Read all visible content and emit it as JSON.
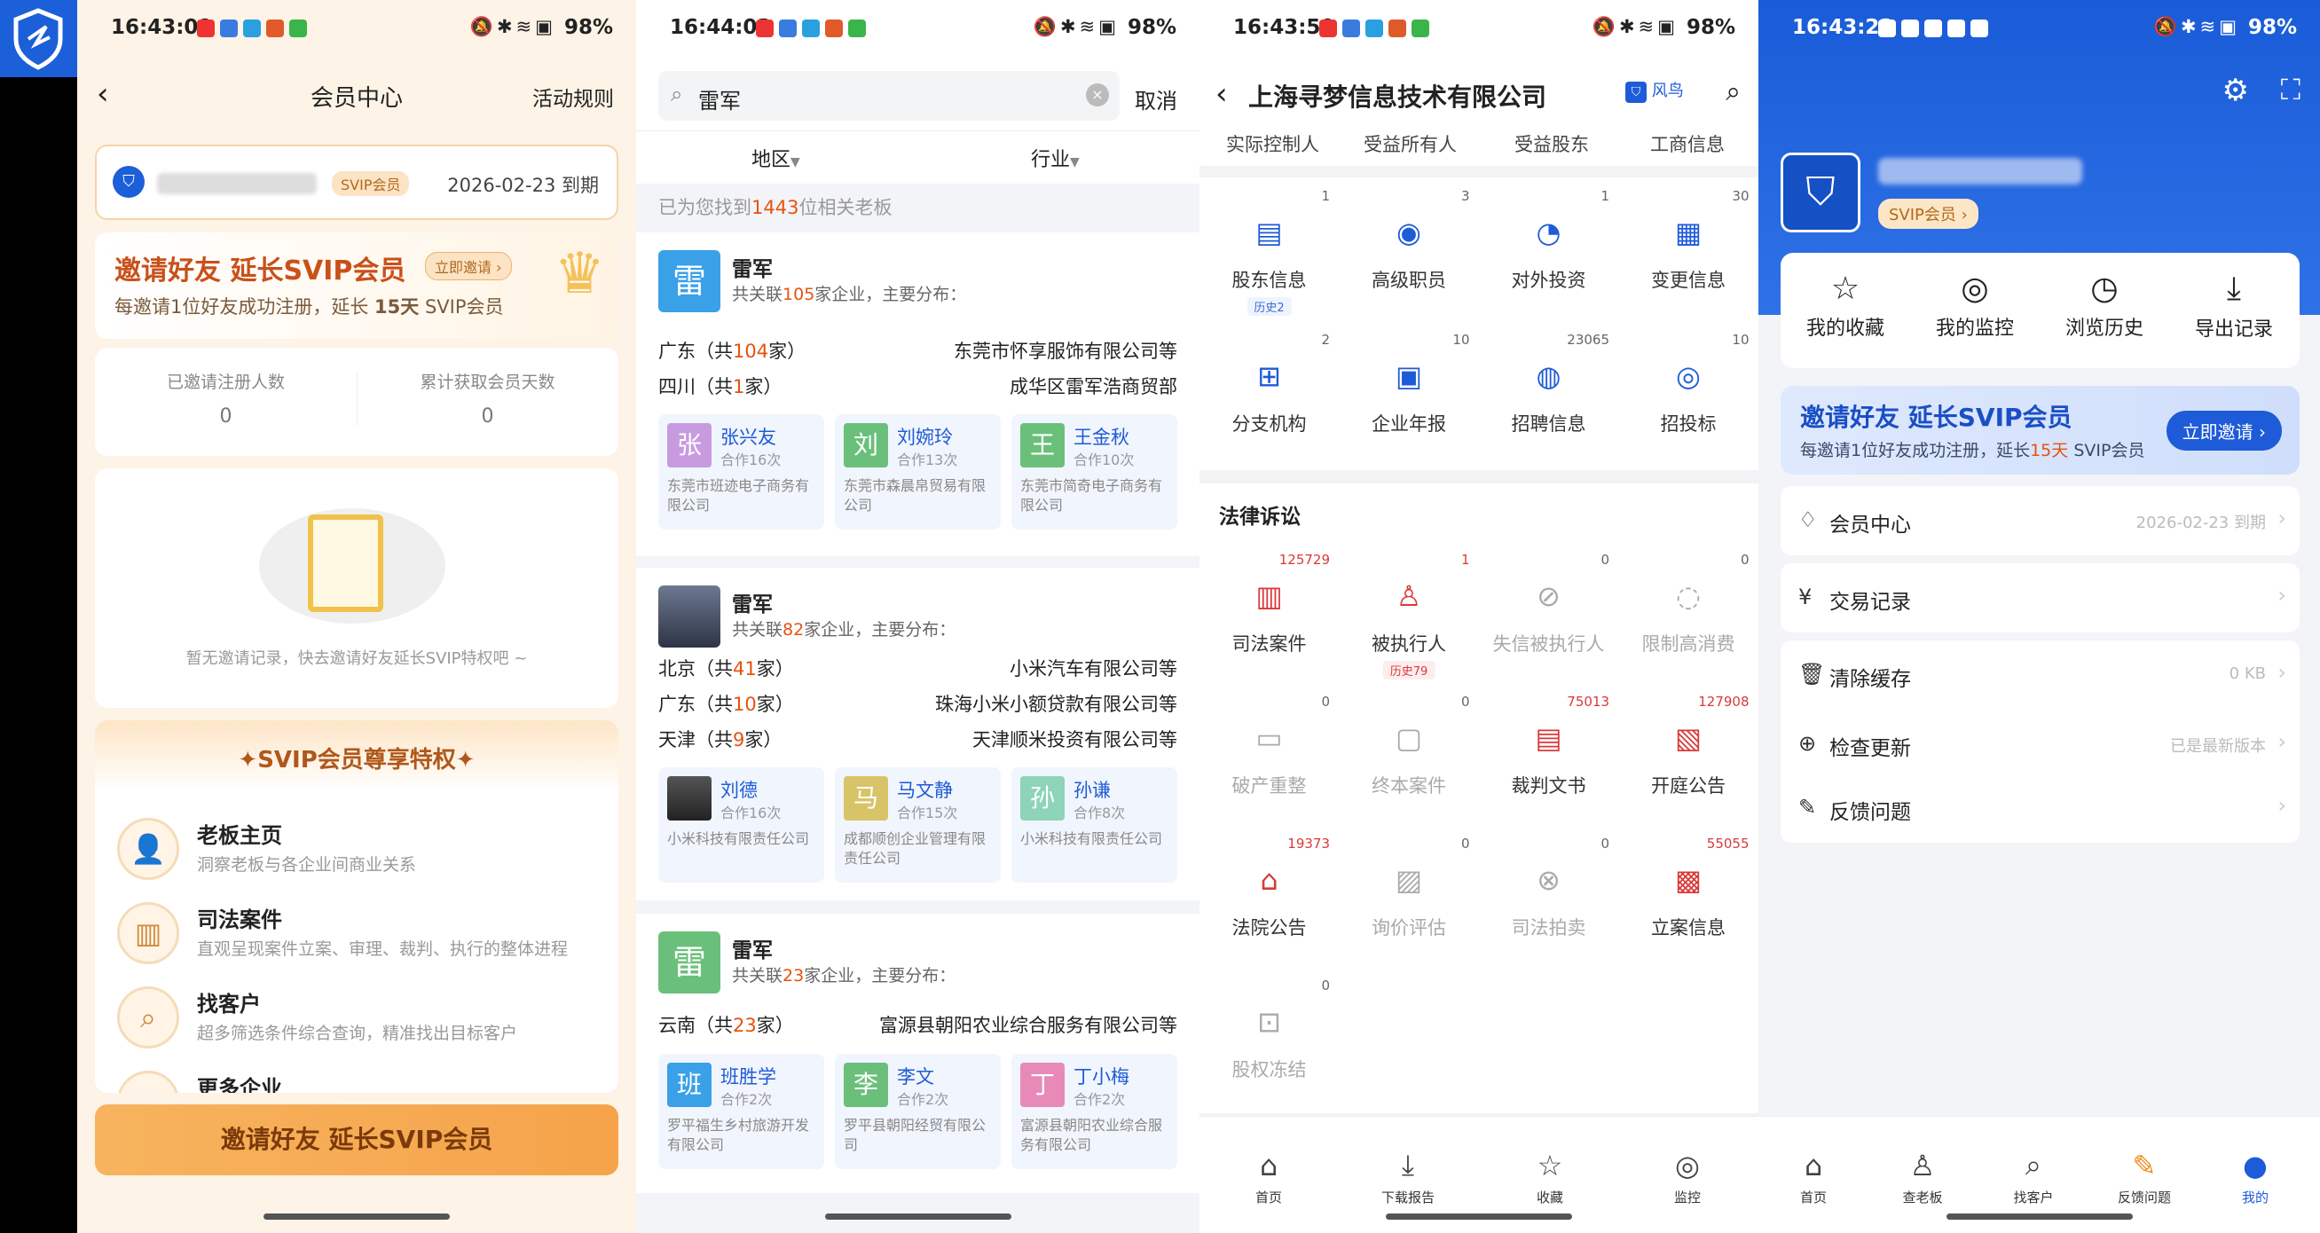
{
  "app_logo_icon": "shield-logo-icon",
  "panel1": {
    "status": {
      "time": "16:43:09",
      "battery": "98%"
    },
    "nav": {
      "title": "会员中心",
      "right": "活动规则"
    },
    "member": {
      "badge": "SVIP会员",
      "expire": "2026-02-23 到期"
    },
    "invite_banner": {
      "title": "邀请好友 延长SVIP会员",
      "btn": "立即邀请",
      "desc_pre": "每邀请1位好友成功注册，延长 ",
      "desc_days": "15天",
      "desc_post": " SVIP会员"
    },
    "stats": [
      {
        "label": "已邀请注册人数",
        "value": "0"
      },
      {
        "label": "累计获取会员天数",
        "value": "0"
      }
    ],
    "empty_text": "暂无邀请记录，快去邀请好友延长SVIP特权吧 ~",
    "priv_title": "✦SVIP会员尊享特权✦",
    "privileges": [
      {
        "title": "老板主页",
        "desc": "洞察老板与各企业间商业关系"
      },
      {
        "title": "司法案件",
        "desc": "直观呈现案件立案、审理、裁判、执行的整体进程"
      },
      {
        "title": "找客户",
        "desc": "超多筛选条件综合查询，精准找出目标客户"
      },
      {
        "title": "更多企业",
        "desc": ""
      }
    ],
    "bottom_btn": "邀请好友 延长SVIP会员"
  },
  "panel2": {
    "status": {
      "time": "16:44:03",
      "battery": "98%"
    },
    "search": {
      "value": "雷军",
      "cancel": "取消"
    },
    "filters": [
      "地区",
      "行业"
    ],
    "found": {
      "pre": "已为您找到",
      "count": "1443",
      "post": "位相关老板"
    },
    "results": [
      {
        "avatar": "雷",
        "name": "雷军",
        "sub_pre": "共关联",
        "sub_num": "105",
        "sub_post": "家企业，主要分布：",
        "rows": [
          {
            "l": "广东（共",
            "n": "104",
            "r": "家）",
            "co": "东莞市怀享服饰有限公司等"
          },
          {
            "l": "四川（共",
            "n": "1",
            "r": "家）",
            "co": "成华区雷军浩商贸部"
          }
        ],
        "partners": [
          {
            "a": "张",
            "n": "张兴友",
            "c": "合作16次",
            "co": "东莞市班迹电子商务有限公司"
          },
          {
            "a": "刘",
            "n": "刘婉玲",
            "c": "合作13次",
            "co": "东莞市森晨帛贸易有限公司"
          },
          {
            "a": "王",
            "n": "王金秋",
            "c": "合作10次",
            "co": "东莞市简奇电子商务有限公司"
          }
        ]
      },
      {
        "avatar": "",
        "name": "雷军",
        "sub_pre": "共关联",
        "sub_num": "82",
        "sub_post": "家企业，主要分布：",
        "rows": [
          {
            "l": "北京（共",
            "n": "41",
            "r": "家）",
            "co": "小米汽车有限公司等"
          },
          {
            "l": "广东（共",
            "n": "10",
            "r": "家）",
            "co": "珠海小米小额贷款有限公司等"
          },
          {
            "l": "天津（共",
            "n": "9",
            "r": "家）",
            "co": "天津顺米投资有限公司等"
          }
        ],
        "partners": [
          {
            "a": "",
            "n": "刘德",
            "c": "合作16次",
            "co": "小米科技有限责任公司"
          },
          {
            "a": "马",
            "n": "马文静",
            "c": "合作15次",
            "co": "成都顺创企业管理有限责任公司"
          },
          {
            "a": "孙",
            "n": "孙谦",
            "c": "合作8次",
            "co": "小米科技有限责任公司"
          }
        ]
      },
      {
        "avatar": "雷",
        "name": "雷军",
        "sub_pre": "共关联",
        "sub_num": "23",
        "sub_post": "家企业，主要分布：",
        "rows": [
          {
            "l": "云南（共",
            "n": "23",
            "r": "家）",
            "co": "富源县朝阳农业综合服务有限公司等"
          }
        ],
        "partners": [
          {
            "a": "班",
            "n": "班胜学",
            "c": "合作2次",
            "co": "罗平福生乡村旅游开发有限公司"
          },
          {
            "a": "李",
            "n": "李文",
            "c": "合作2次",
            "co": "罗平县朝阳经贸有限公司"
          },
          {
            "a": "丁",
            "n": "丁小梅",
            "c": "合作2次",
            "co": "富源县朝阳农业综合服务有限公司"
          }
        ]
      }
    ]
  },
  "panel3": {
    "status": {
      "time": "16:43:50",
      "battery": "98%"
    },
    "nav": {
      "title": "上海寻梦信息技术有限公司",
      "brand": "风鸟"
    },
    "top_tabs": [
      "实际控制人",
      "受益所有人",
      "受益股东",
      "工商信息"
    ],
    "grid1": [
      {
        "label": "股东信息",
        "n": "1",
        "hist": "历史2",
        "icon": "shareholder-icon"
      },
      {
        "label": "高级职员",
        "n": "3",
        "icon": "staff-icon"
      },
      {
        "label": "对外投资",
        "n": "1",
        "icon": "investment-icon"
      },
      {
        "label": "变更信息",
        "n": "30",
        "icon": "change-icon"
      },
      {
        "label": "分支机构",
        "n": "2",
        "icon": "branch-icon"
      },
      {
        "label": "企业年报",
        "n": "10",
        "icon": "report-icon"
      },
      {
        "label": "招聘信息",
        "n": "23065",
        "icon": "recruit-icon"
      },
      {
        "label": "招投标",
        "n": "10",
        "icon": "bid-icon"
      }
    ],
    "section_title": "法律诉讼",
    "grid2": [
      {
        "label": "司法案件",
        "n": "125729",
        "red": true,
        "icon": "judicial-icon"
      },
      {
        "label": "被执行人",
        "n": "1",
        "red": true,
        "hist": "历史79",
        "icon": "executed-person-icon"
      },
      {
        "label": "失信被执行人",
        "n": "0",
        "dim": true,
        "icon": "dishonest-icon"
      },
      {
        "label": "限制高消费",
        "n": "0",
        "dim": true,
        "icon": "restrict-icon"
      },
      {
        "label": "破产重整",
        "n": "0",
        "dim": true,
        "icon": "bankrupt-icon"
      },
      {
        "label": "终本案件",
        "n": "0",
        "dim": true,
        "icon": "terminated-case-icon"
      },
      {
        "label": "裁判文书",
        "n": "75013",
        "red": true,
        "icon": "judgment-icon"
      },
      {
        "label": "开庭公告",
        "n": "127908",
        "red": true,
        "icon": "hearing-icon"
      },
      {
        "label": "法院公告",
        "n": "19373",
        "red": true,
        "icon": "court-icon"
      },
      {
        "label": "询价评估",
        "n": "0",
        "dim": true,
        "icon": "appraisal-icon"
      },
      {
        "label": "司法拍卖",
        "n": "0",
        "dim": true,
        "icon": "auction-icon"
      },
      {
        "label": "立案信息",
        "n": "55055",
        "red": true,
        "icon": "filing-icon"
      },
      {
        "label": "股权冻结",
        "n": "0",
        "dim": true,
        "icon": "freeze-icon"
      }
    ],
    "tabs": [
      "首页",
      "下载报告",
      "收藏",
      "监控"
    ]
  },
  "panel4": {
    "status": {
      "time": "16:43:22",
      "battery": "98%"
    },
    "badge": "SVIP会员",
    "quick": [
      "我的收藏",
      "我的监控",
      "浏览历史",
      "导出记录"
    ],
    "invite": {
      "title": "邀请好友 延长SVIP会员",
      "desc_pre": "每邀请1位好友成功注册，延长",
      "days": "15天",
      "desc_post": " SVIP会员",
      "btn": "立即邀请"
    },
    "menu": [
      {
        "label": "会员中心",
        "right": "2026-02-23 到期",
        "icon": "vip-icon"
      },
      {
        "label": "交易记录",
        "right": "",
        "icon": "yen-icon"
      },
      {
        "label": "清除缓存",
        "right": "0 KB",
        "icon": "trash-icon"
      },
      {
        "label": "检查更新",
        "right": "已是最新版本",
        "icon": "update-icon"
      },
      {
        "label": "反馈问题",
        "right": "",
        "icon": "feedback-icon"
      }
    ],
    "tabs": [
      "首页",
      "查老板",
      "找客户",
      "反馈问题",
      "我的"
    ]
  }
}
